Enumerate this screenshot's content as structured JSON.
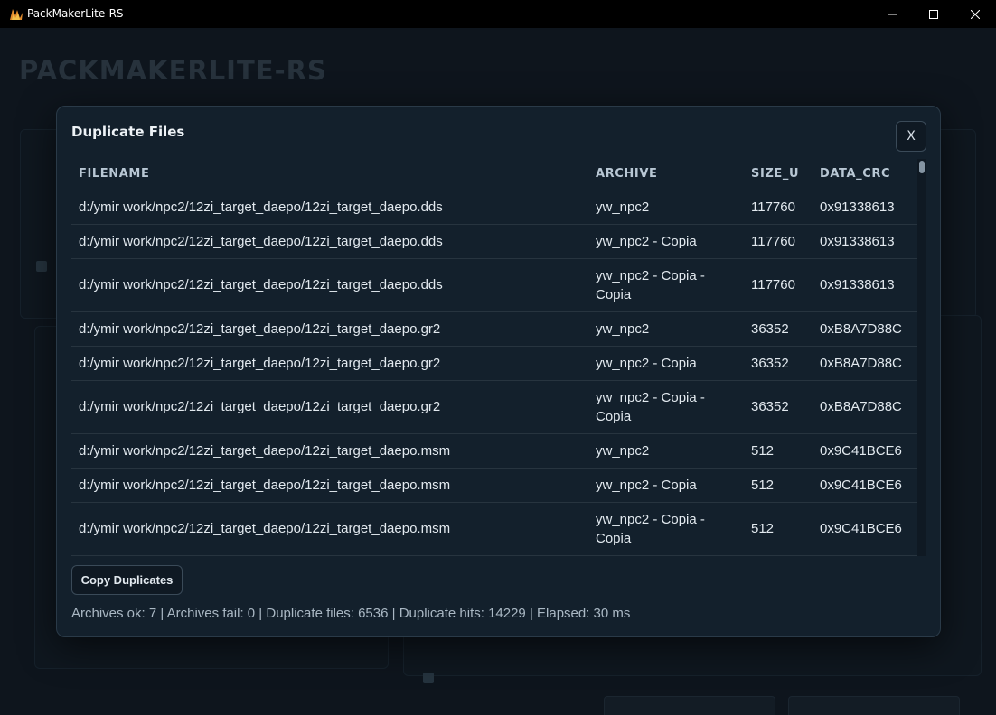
{
  "window": {
    "title": "PackMakerLite-RS",
    "minimize_glyph": "—",
    "maximize_glyph": "☐",
    "close_glyph": "✕"
  },
  "background": {
    "app_heading": "PACKMAKERLITE-RS"
  },
  "modal": {
    "title": "Duplicate Files",
    "close_label": "X",
    "columns": [
      "FILENAME",
      "ARCHIVE",
      "SIZE_U",
      "DATA_CRC"
    ],
    "rows": [
      {
        "filename": "d:/ymir work/npc2/12zi_target_daepo/12zi_target_daepo.dds",
        "archive": "yw_npc2",
        "size_u": "117760",
        "data_crc": "0x91338613"
      },
      {
        "filename": "d:/ymir work/npc2/12zi_target_daepo/12zi_target_daepo.dds",
        "archive": "yw_npc2 - Copia",
        "size_u": "117760",
        "data_crc": "0x91338613"
      },
      {
        "filename": "d:/ymir work/npc2/12zi_target_daepo/12zi_target_daepo.dds",
        "archive": "yw_npc2 - Copia - Copia",
        "size_u": "117760",
        "data_crc": "0x91338613"
      },
      {
        "filename": "d:/ymir work/npc2/12zi_target_daepo/12zi_target_daepo.gr2",
        "archive": "yw_npc2",
        "size_u": "36352",
        "data_crc": "0xB8A7D88C"
      },
      {
        "filename": "d:/ymir work/npc2/12zi_target_daepo/12zi_target_daepo.gr2",
        "archive": "yw_npc2 - Copia",
        "size_u": "36352",
        "data_crc": "0xB8A7D88C"
      },
      {
        "filename": "d:/ymir work/npc2/12zi_target_daepo/12zi_target_daepo.gr2",
        "archive": "yw_npc2 - Copia - Copia",
        "size_u": "36352",
        "data_crc": "0xB8A7D88C"
      },
      {
        "filename": "d:/ymir work/npc2/12zi_target_daepo/12zi_target_daepo.msm",
        "archive": "yw_npc2",
        "size_u": "512",
        "data_crc": "0x9C41BCE6"
      },
      {
        "filename": "d:/ymir work/npc2/12zi_target_daepo/12zi_target_daepo.msm",
        "archive": "yw_npc2 - Copia",
        "size_u": "512",
        "data_crc": "0x9C41BCE6"
      },
      {
        "filename": "d:/ymir work/npc2/12zi_target_daepo/12zi_target_daepo.msm",
        "archive": "yw_npc2 - Copia - Copia",
        "size_u": "512",
        "data_crc": "0x9C41BCE6"
      }
    ],
    "copy_button_label": "Copy Duplicates",
    "stats": "Archives ok: 7 | Archives fail: 0 | Duplicate files: 6536 | Duplicate hits: 14229 | Elapsed: 30 ms"
  },
  "colors": {
    "modal_bg": "#13202c",
    "page_bg": "#0e151d",
    "text": "#e2e9ef",
    "header_text": "#b8c7d4"
  }
}
